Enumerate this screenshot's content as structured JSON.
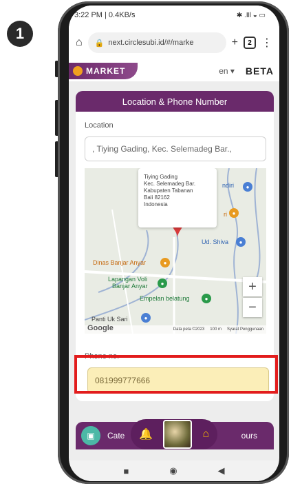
{
  "step": {
    "number": "1"
  },
  "status_bar": {
    "left": "3:22 PM | 0.4KB/s",
    "right": "✱ .Ⅱl ◒ ▭"
  },
  "browser": {
    "url": "next.circlesubi.id/#/marke",
    "tab_count": "2"
  },
  "header": {
    "logo_text": "MARKET",
    "language": "en",
    "beta": "BETA"
  },
  "location_section": {
    "title": "Location & Phone Number",
    "location_label": "Location",
    "location_value": ", Tiying Gading, Kec. Selemadeg Bar.,",
    "map": {
      "bubble_lines": [
        "Tiying Gading",
        "Kec. Selemadeg Bar.",
        "Kabupaten Tabanan",
        "Bali 82162",
        "Indonesia"
      ],
      "pois": {
        "mandiri": "ndiri",
        "ri": "ri",
        "ud_shiva": "Ud. Shiva",
        "dinas": "Dinas Banjar Anyar",
        "lapangan_1": "Lapangan Voli",
        "lapangan_2": "Banjar Anyar",
        "empelan": "Empelan belatung",
        "panti": "Panti Uk Sari"
      },
      "zoom_in": "+",
      "zoom_out": "−",
      "attribution_google": "Google",
      "attribution_data": "Data peta ©2023",
      "attribution_scale": "100 m",
      "attribution_terms": "Syarat Penggunaan"
    },
    "phone_label": "Phone no.",
    "phone_value": "081999777666"
  },
  "category_bar": {
    "left_text": "Cate",
    "right_text": "ours"
  },
  "colors": {
    "brand_purple": "#6a2a6b",
    "highlight_red": "#e21c1c",
    "phone_fill": "#fbeeb8"
  }
}
